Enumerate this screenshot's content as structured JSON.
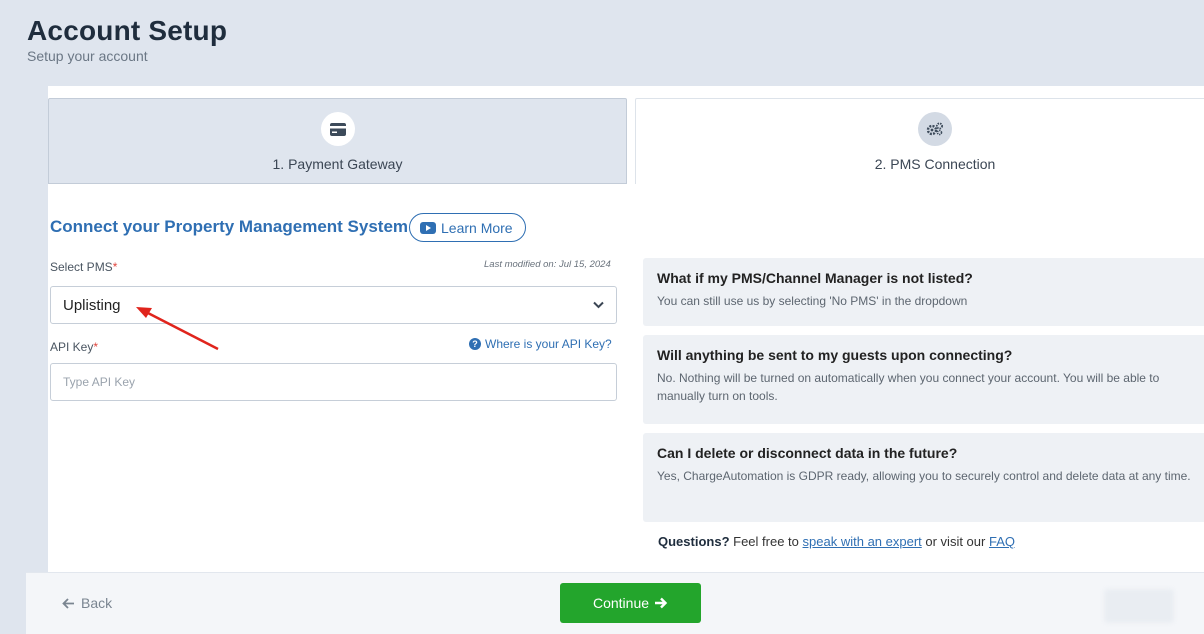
{
  "header": {
    "title": "Account Setup",
    "subtitle": "Setup your account"
  },
  "steps": [
    {
      "label": "1. Payment Gateway",
      "icon": "credit-card-icon",
      "state": "completed"
    },
    {
      "label": "2. PMS Connection",
      "icon": "gears-icon",
      "state": "active"
    }
  ],
  "form": {
    "section_title": "Connect your Property Management System",
    "learn_more_label": "Learn More",
    "pms_label": "Select PMS",
    "required_marker": "*",
    "last_modified": "Last modified on: Jul 15, 2024",
    "pms_value": "Uplisting",
    "api_key_label": "API Key",
    "api_help_label": "Where is your API Key?",
    "api_key_placeholder": "Type API Key",
    "api_key_value": ""
  },
  "faq": [
    {
      "question": "What if my PMS/Channel Manager is not listed?",
      "answer": "You can still use us by selecting 'No PMS' in the dropdown"
    },
    {
      "question": "Will anything be sent to my guests upon connecting?",
      "answer": "No. Nothing will be turned on automatically when you connect your account. You will be able to manually turn on tools."
    },
    {
      "question": "Can I delete or disconnect data in the future?",
      "answer": "Yes, ChargeAutomation is GDPR ready, allowing you to securely control and delete data at any time."
    }
  ],
  "questions": {
    "lead": "Questions?",
    "text1": "Feel free to",
    "link1": "speak with an expert",
    "text2": "or visit our",
    "link2": "FAQ"
  },
  "footer": {
    "back_label": "Back",
    "continue_label": "Continue"
  },
  "colors": {
    "accent": "#2f6fb3",
    "primary_button": "#23a52c",
    "annotation_arrow": "#e0241c"
  }
}
